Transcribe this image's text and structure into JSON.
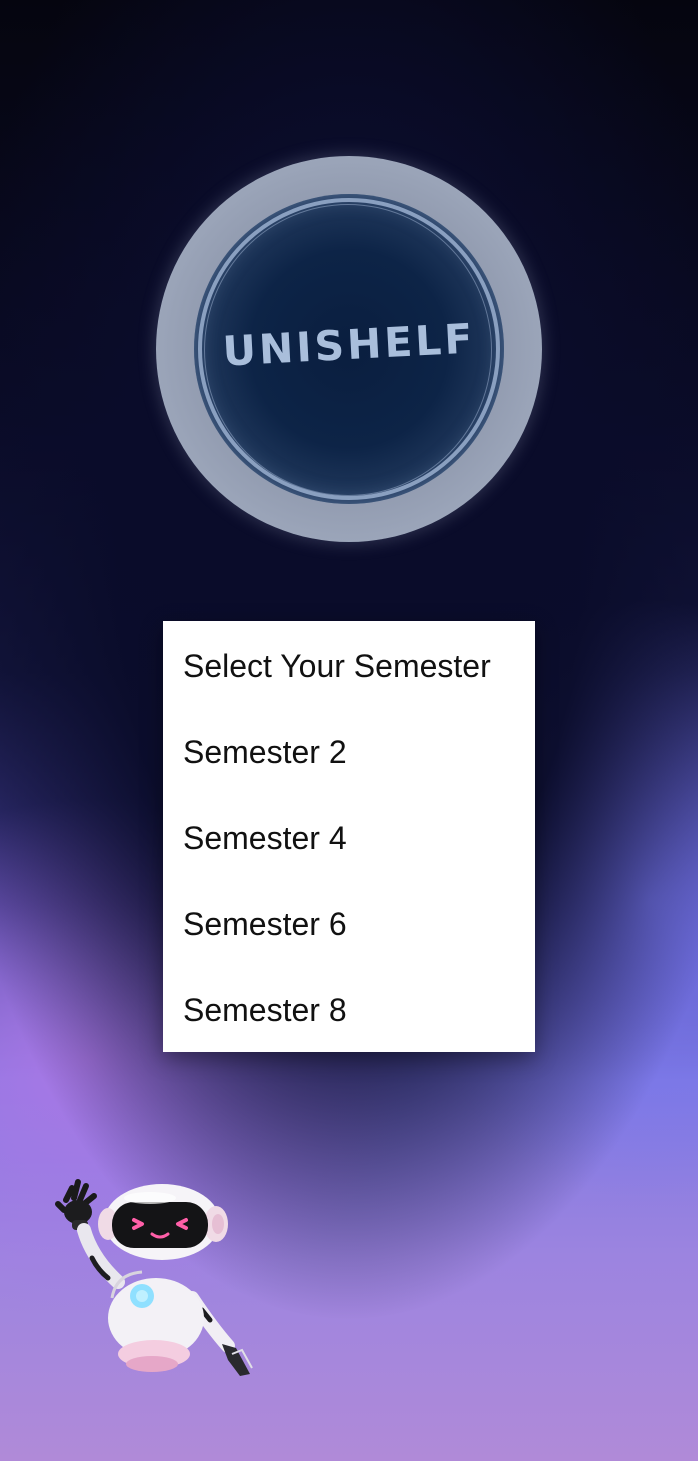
{
  "logo": {
    "text": "UNISHELF"
  },
  "semester_menu": {
    "items": [
      "Select Your Semester",
      "Semester 2",
      "Semester 4",
      "Semester 6",
      "Semester 8"
    ]
  },
  "mascot": {
    "icon": "waving-robot-icon"
  }
}
